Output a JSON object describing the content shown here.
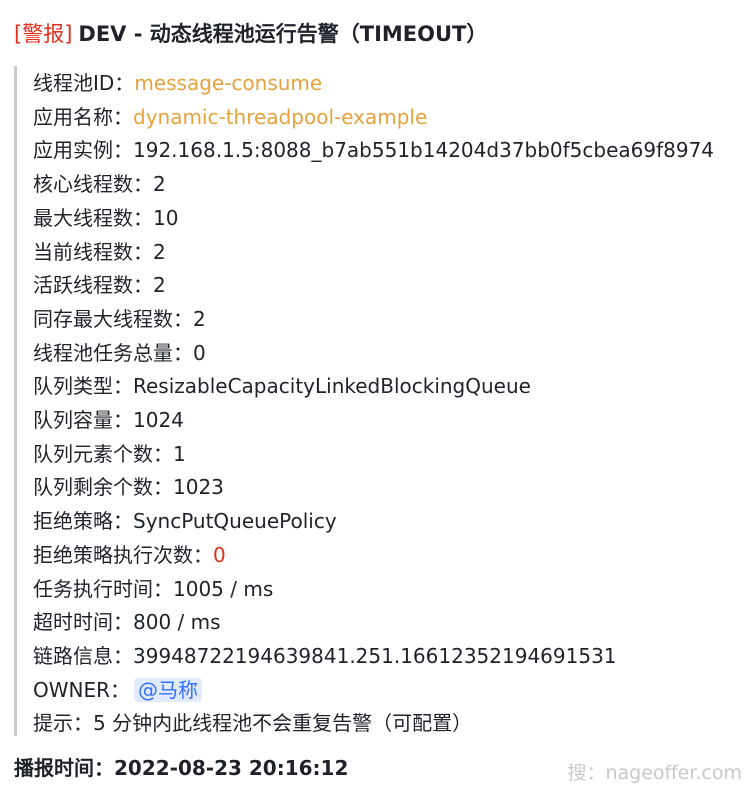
{
  "title": {
    "tag": "[警报]",
    "text": "DEV - 动态线程池运行告警（TIMEOUT）"
  },
  "fields": [
    {
      "label": "线程池ID：",
      "value": "message-consume"
    },
    {
      "label": "应用名称：",
      "value": "dynamic-threadpool-example"
    },
    {
      "label": "应用实例：",
      "value": "192.168.1.5:8088_b7ab551b14204d37bb0f5cbea69f8974"
    },
    {
      "label": "核心线程数：",
      "value": "2"
    },
    {
      "label": "最大线程数：",
      "value": "10"
    },
    {
      "label": "当前线程数：",
      "value": "2"
    },
    {
      "label": "活跃线程数：",
      "value": "2"
    },
    {
      "label": "同存最大线程数：",
      "value": "2"
    },
    {
      "label": "线程池任务总量：",
      "value": "0"
    },
    {
      "label": "队列类型：",
      "value": "ResizableCapacityLinkedBlockingQueue"
    },
    {
      "label": "队列容量：",
      "value": "1024"
    },
    {
      "label": "队列元素个数：",
      "value": "1"
    },
    {
      "label": "队列剩余个数：",
      "value": "1023"
    },
    {
      "label": "拒绝策略：",
      "value": "SyncPutQueuePolicy"
    },
    {
      "label": "拒绝策略执行次数：",
      "value": "0"
    },
    {
      "label": "任务执行时间：",
      "value": "1005 / ms"
    },
    {
      "label": "超时时间：",
      "value": "800 / ms"
    },
    {
      "label": "链路信息：",
      "value": "39948722194639841.251.16612352194691531"
    },
    {
      "label": "OWNER：",
      "value": "@马称"
    },
    {
      "label": "提示：",
      "value": "5 分钟内此线程池不会重复告警（可配置）"
    }
  ],
  "footer": {
    "label": "播报时间：",
    "value": "2022-08-23 20:16:12"
  },
  "watermark": "搜：nageoffer.com",
  "colors": {
    "tag": "#e0301e",
    "highlight_value": "#e6a23c",
    "alert_value": "#e0301e",
    "mention_text": "#3370ff",
    "mention_bg": "#e1eaff",
    "quote_bar": "#c8cbd0"
  }
}
